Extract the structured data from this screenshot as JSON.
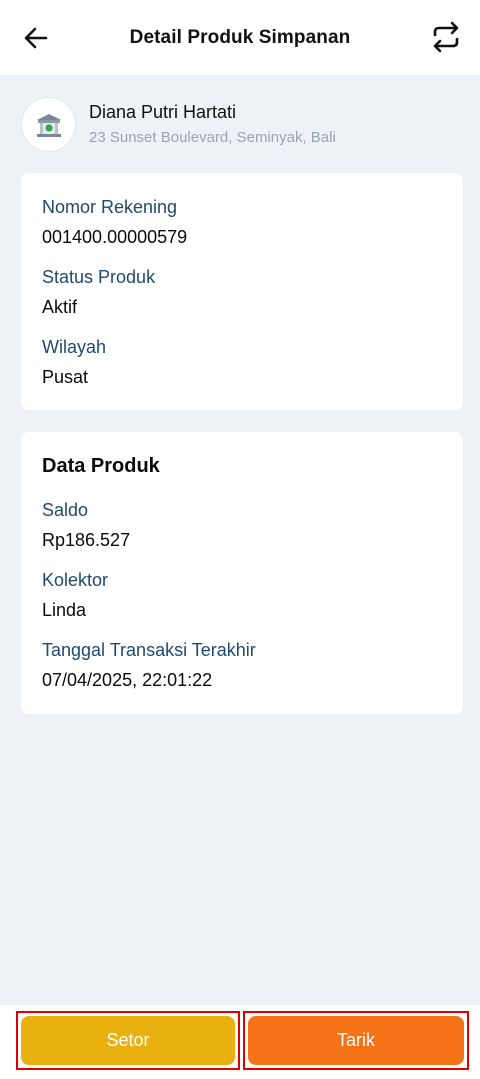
{
  "header": {
    "title": "Detail Produk Simpanan",
    "back_icon": "arrow-left-icon",
    "switch_icon": "swap-arrows-icon"
  },
  "profile": {
    "avatar_icon": "bank-building-icon",
    "name": "Diana Putri Hartati",
    "address": "23 Sunset Boulevard, Seminyak, Bali"
  },
  "account": {
    "fields": [
      {
        "label": "Nomor Rekening",
        "value": "001400.00000579"
      },
      {
        "label": "Status Produk",
        "value": "Aktif"
      },
      {
        "label": "Wilayah",
        "value": "Pusat"
      }
    ]
  },
  "product": {
    "title": "Data Produk",
    "fields": [
      {
        "label": "Saldo",
        "value": "Rp186.527"
      },
      {
        "label": "Kolektor",
        "value": "Linda"
      },
      {
        "label": "Tanggal Transaksi Terakhir",
        "value": "07/04/2025, 22:01:22"
      }
    ]
  },
  "actions": {
    "setor_label": "Setor",
    "tarik_label": "Tarik"
  },
  "colors": {
    "setor": "#e9b10f",
    "tarik": "#f57216",
    "label": "#1e4a6e",
    "background": "#eef2f7"
  }
}
